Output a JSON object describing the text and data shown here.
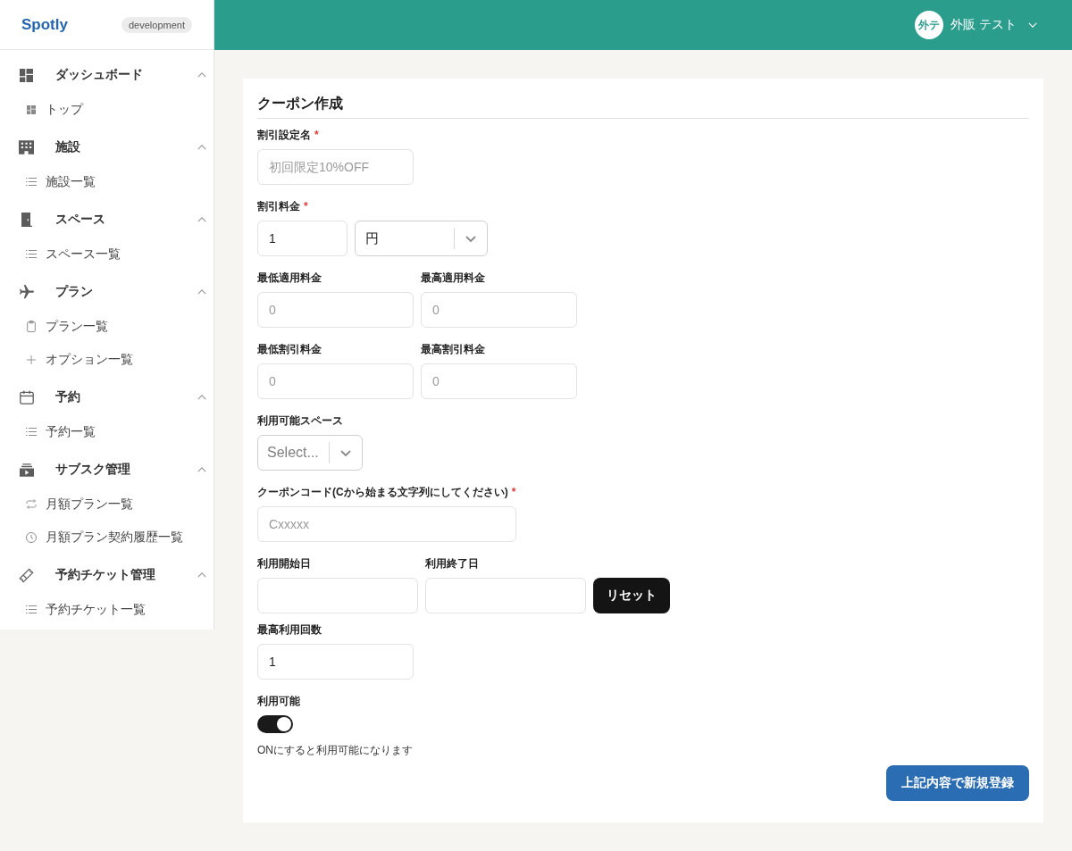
{
  "sidebar": {
    "logo": "Spotly",
    "env_badge": "development",
    "groups": [
      {
        "label": "ダッシュボード",
        "expanded": true,
        "children": [
          {
            "label": "トップ"
          }
        ]
      },
      {
        "label": "施設",
        "expanded": true,
        "children": [
          {
            "label": "施設一覧"
          }
        ]
      },
      {
        "label": "スペース",
        "expanded": true,
        "children": [
          {
            "label": "スペース一覧"
          }
        ]
      },
      {
        "label": "プラン",
        "expanded": true,
        "children": [
          {
            "label": "プラン一覧"
          },
          {
            "label": "オプション一覧"
          }
        ]
      },
      {
        "label": "予約",
        "expanded": true,
        "children": [
          {
            "label": "予約一覧"
          }
        ]
      },
      {
        "label": "サブスク管理",
        "expanded": true,
        "children": [
          {
            "label": "月額プラン一覧"
          },
          {
            "label": "月額プラン契約履歴一覧"
          }
        ]
      },
      {
        "label": "予約チケット管理",
        "expanded": true,
        "children": [
          {
            "label": "予約チケット一覧"
          }
        ]
      }
    ]
  },
  "header": {
    "user": {
      "avatar_text": "外テ",
      "name": "外販 テスト"
    }
  },
  "form": {
    "title": "クーポン作成",
    "discount_name": {
      "label": "割引設定名",
      "required_mark": "*",
      "placeholder": "初回限定10%OFF"
    },
    "discount_amount": {
      "label": "割引料金",
      "required_mark": "*",
      "value": "1",
      "unit": "円"
    },
    "min_apply_price": {
      "label": "最低適用料金",
      "placeholder": "0"
    },
    "max_apply_price": {
      "label": "最高適用料金",
      "placeholder": "0"
    },
    "min_discount": {
      "label": "最低割引料金",
      "placeholder": "0"
    },
    "max_discount": {
      "label": "最高割引料金",
      "placeholder": "0"
    },
    "available_spaces": {
      "label": "利用可能スペース",
      "placeholder": "Select..."
    },
    "coupon_code": {
      "label": "クーポンコード(Cから始まる文字列にしてください)",
      "required_mark": "*",
      "placeholder": "Cxxxxx"
    },
    "start_date": {
      "label": "利用開始日"
    },
    "end_date": {
      "label": "利用終了日"
    },
    "reset_button": "リセット",
    "max_uses": {
      "label": "最高利用回数",
      "value": "1"
    },
    "available": {
      "label": "利用可能",
      "on": true,
      "help": "ONにすると利用可能になります"
    },
    "submit_button": "上記内容で新規登録"
  }
}
